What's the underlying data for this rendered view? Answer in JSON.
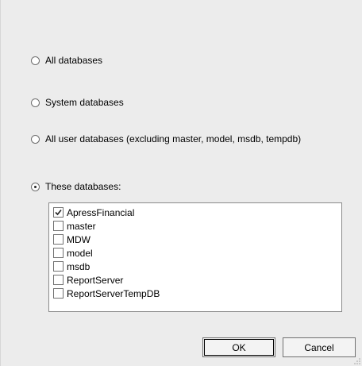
{
  "scope_options": [
    {
      "label": "All databases",
      "selected": false
    },
    {
      "label": "System databases",
      "selected": false
    },
    {
      "label": "All user databases  (excluding master, model, msdb, tempdb)",
      "selected": false
    },
    {
      "label": "These databases:",
      "selected": true
    }
  ],
  "databases": [
    {
      "name": "ApressFinancial",
      "checked": true
    },
    {
      "name": "master",
      "checked": false
    },
    {
      "name": "MDW",
      "checked": false
    },
    {
      "name": "model",
      "checked": false
    },
    {
      "name": "msdb",
      "checked": false
    },
    {
      "name": "ReportServer",
      "checked": false
    },
    {
      "name": "ReportServerTempDB",
      "checked": false
    }
  ],
  "buttons": {
    "ok_label": "OK",
    "cancel_label": "Cancel"
  },
  "icons": {
    "radio": "radio-button-icon",
    "checkbox": "checkbox-icon",
    "check": "checkmark-icon",
    "grip": "resize-grip-icon"
  },
  "colors": {
    "background": "#ececec",
    "list_background": "#ffffff",
    "border": "#707070"
  }
}
